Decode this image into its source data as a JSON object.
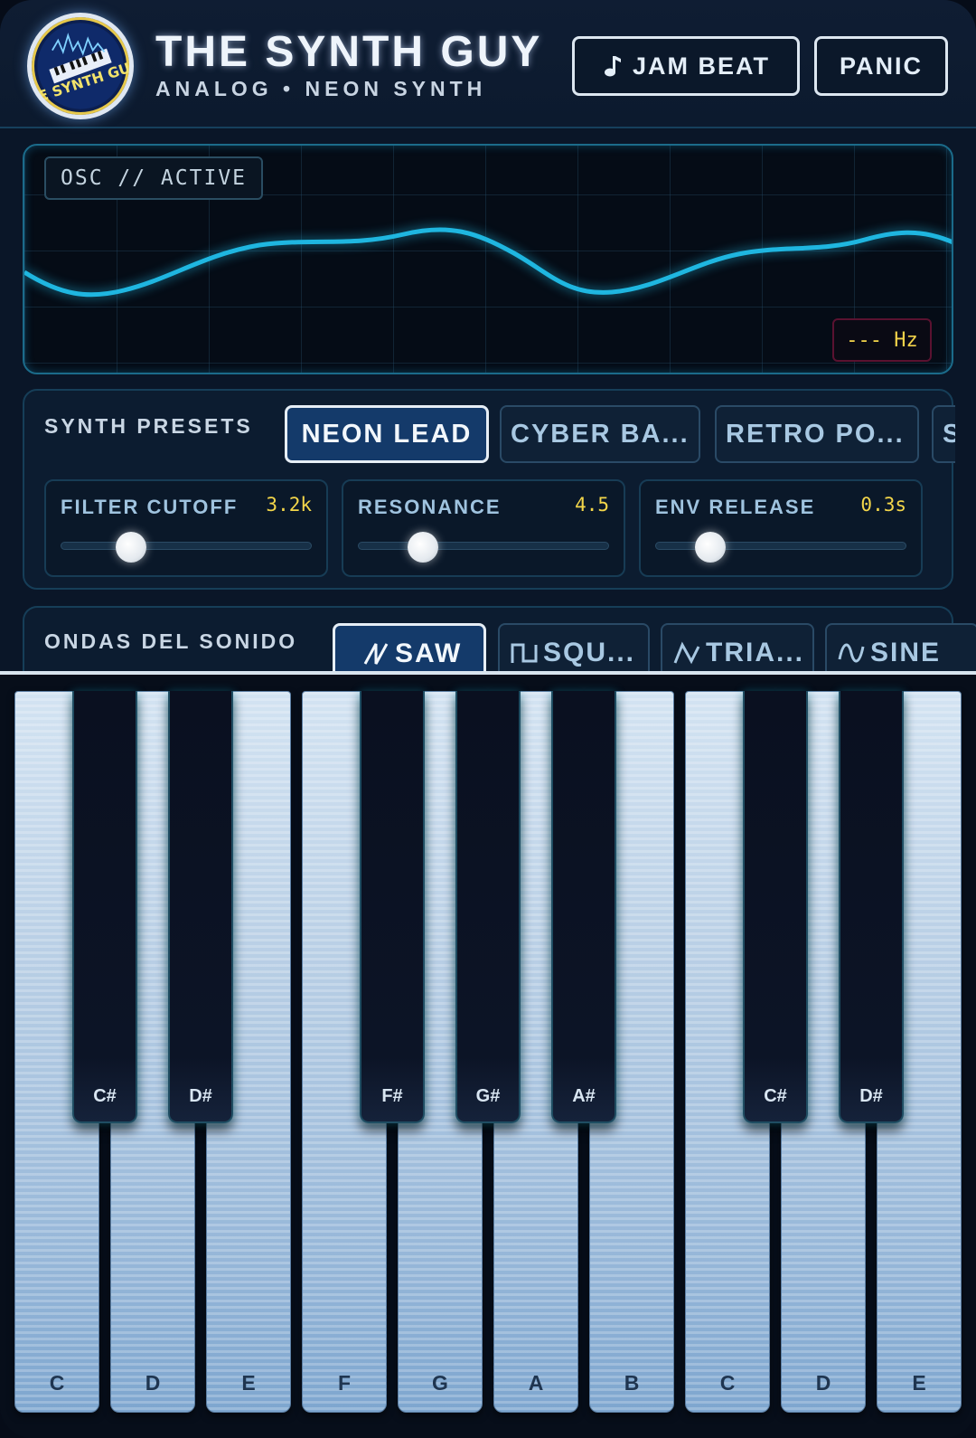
{
  "header": {
    "title": "THE SYNTH GUY",
    "subtitle": "ANALOG • NEON SYNTH",
    "jam_label": "JAM BEAT",
    "panic_label": "PANIC",
    "logo_text": "THE SYNTH GUY"
  },
  "osc": {
    "label": "OSC // ACTIVE",
    "frequency": "--- Hz",
    "accent": "#1fb6e0"
  },
  "presets": {
    "section_label": "SYNTH PRESETS",
    "items": [
      {
        "label": "NEON LEAD",
        "active": true
      },
      {
        "label": "CYBER BA...",
        "active": false
      },
      {
        "label": "RETRO PO...",
        "active": false
      },
      {
        "label": "SY",
        "active": false
      }
    ]
  },
  "controls": [
    {
      "name": "FILTER CUTOFF",
      "value": "3.2k",
      "level": 0.28
    },
    {
      "name": "RESONANCE",
      "value": "4.5",
      "level": 0.26
    },
    {
      "name": "ENV RELEASE",
      "value": "0.3s",
      "level": 0.22
    }
  ],
  "waveforms": {
    "section_label": "ONDAS DEL SONIDO",
    "items": [
      {
        "label": "SAW",
        "icon": "saw-wave-icon",
        "active": true
      },
      {
        "label": "SQU...",
        "icon": "square-wave-icon",
        "active": false
      },
      {
        "label": "TRIA...",
        "icon": "triangle-wave-icon",
        "active": false
      },
      {
        "label": "SINE",
        "icon": "sine-wave-icon",
        "active": false
      }
    ]
  },
  "keyboard": {
    "white_keys": [
      "C",
      "D",
      "E",
      "F",
      "G",
      "A",
      "B",
      "C",
      "D",
      "E"
    ],
    "black_keys": [
      "C#",
      "D#",
      "F#",
      "G#",
      "A#",
      "C#",
      "D#"
    ]
  }
}
